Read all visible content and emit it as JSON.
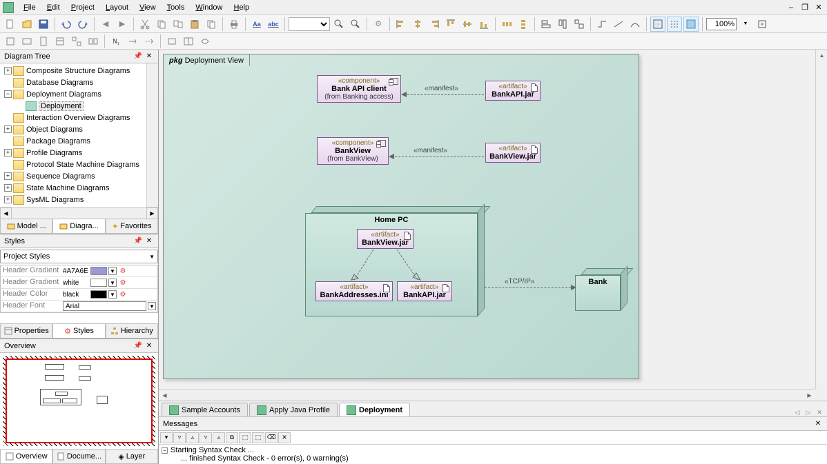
{
  "menubar": [
    "File",
    "Edit",
    "Project",
    "Layout",
    "View",
    "Tools",
    "Window",
    "Help"
  ],
  "zoom": "100%",
  "panels": {
    "tree_title": "Diagram Tree",
    "styles_title": "Styles",
    "overview_title": "Overview",
    "messages_title": "Messages"
  },
  "tree": {
    "items": [
      {
        "indent": 0,
        "exp": "+",
        "type": "folder",
        "label": "Composite Structure Diagrams"
      },
      {
        "indent": 0,
        "exp": "",
        "type": "folder",
        "label": "Database Diagrams"
      },
      {
        "indent": 0,
        "exp": "−",
        "type": "folder",
        "label": "Deployment Diagrams"
      },
      {
        "indent": 1,
        "exp": "",
        "type": "doc",
        "label": "Deployment",
        "selected": true
      },
      {
        "indent": 0,
        "exp": "",
        "type": "folder",
        "label": "Interaction Overview Diagrams"
      },
      {
        "indent": 0,
        "exp": "+",
        "type": "folder",
        "label": "Object Diagrams"
      },
      {
        "indent": 0,
        "exp": "",
        "type": "folder",
        "label": "Package Diagrams"
      },
      {
        "indent": 0,
        "exp": "+",
        "type": "folder",
        "label": "Profile Diagrams"
      },
      {
        "indent": 0,
        "exp": "",
        "type": "folder",
        "label": "Protocol State Machine Diagrams"
      },
      {
        "indent": 0,
        "exp": "+",
        "type": "folder",
        "label": "Sequence Diagrams"
      },
      {
        "indent": 0,
        "exp": "+",
        "type": "folder",
        "label": "State Machine Diagrams"
      },
      {
        "indent": 0,
        "exp": "+",
        "type": "folder",
        "label": "SysML Diagrams"
      }
    ],
    "tabs": [
      "Model ...",
      "Diagra...",
      "Favorites"
    ],
    "active_tab": 1
  },
  "styles": {
    "combo": "Project Styles",
    "rows": [
      {
        "k": "Header Gradient E",
        "v": "#A7A6E",
        "color": "#9a99d8"
      },
      {
        "k": "Header Gradient E",
        "v": "white",
        "color": "#ffffff"
      },
      {
        "k": "Header Color",
        "v": "black",
        "color": "#000000"
      },
      {
        "k": "Header Font",
        "v": "Arial"
      }
    ],
    "tabs": [
      "Properties",
      "Styles",
      "Hierarchy"
    ],
    "active_tab": 1
  },
  "overview": {
    "tabs": [
      "Overview",
      "Docume...",
      "Layer"
    ],
    "active_tab": 0
  },
  "diagram": {
    "pkg_prefix": "pkg",
    "pkg_name": "Deployment View",
    "comp1": {
      "stereo": "«component»",
      "name": "Bank API client",
      "from": "(from Banking access)"
    },
    "art1": {
      "stereo": "«artifact»",
      "name": "BankAPI.jar"
    },
    "comp2": {
      "stereo": "«component»",
      "name": "BankView",
      "from": "(from BankView)"
    },
    "art2": {
      "stereo": "«artifact»",
      "name": "BankView.jar"
    },
    "node1": {
      "name": "Home PC"
    },
    "art3": {
      "stereo": "«artifact»",
      "name": "BankView.jar"
    },
    "art4": {
      "stereo": "«artifact»",
      "name": "BankAddresses.ini"
    },
    "art5": {
      "stereo": "«artifact»",
      "name": "BankAPI.jar"
    },
    "node2": {
      "name": "Bank"
    },
    "manifest": "«manifest»",
    "tcpip": "«TCP/IP»"
  },
  "doc_tabs": {
    "tabs": [
      "Sample Accounts",
      "Apply Java Profile",
      "Deployment"
    ],
    "active": 2
  },
  "messages": {
    "line1": "Starting Syntax Check ...",
    "line2": "... finished Syntax Check - 0 error(s), 0 warning(s)"
  }
}
